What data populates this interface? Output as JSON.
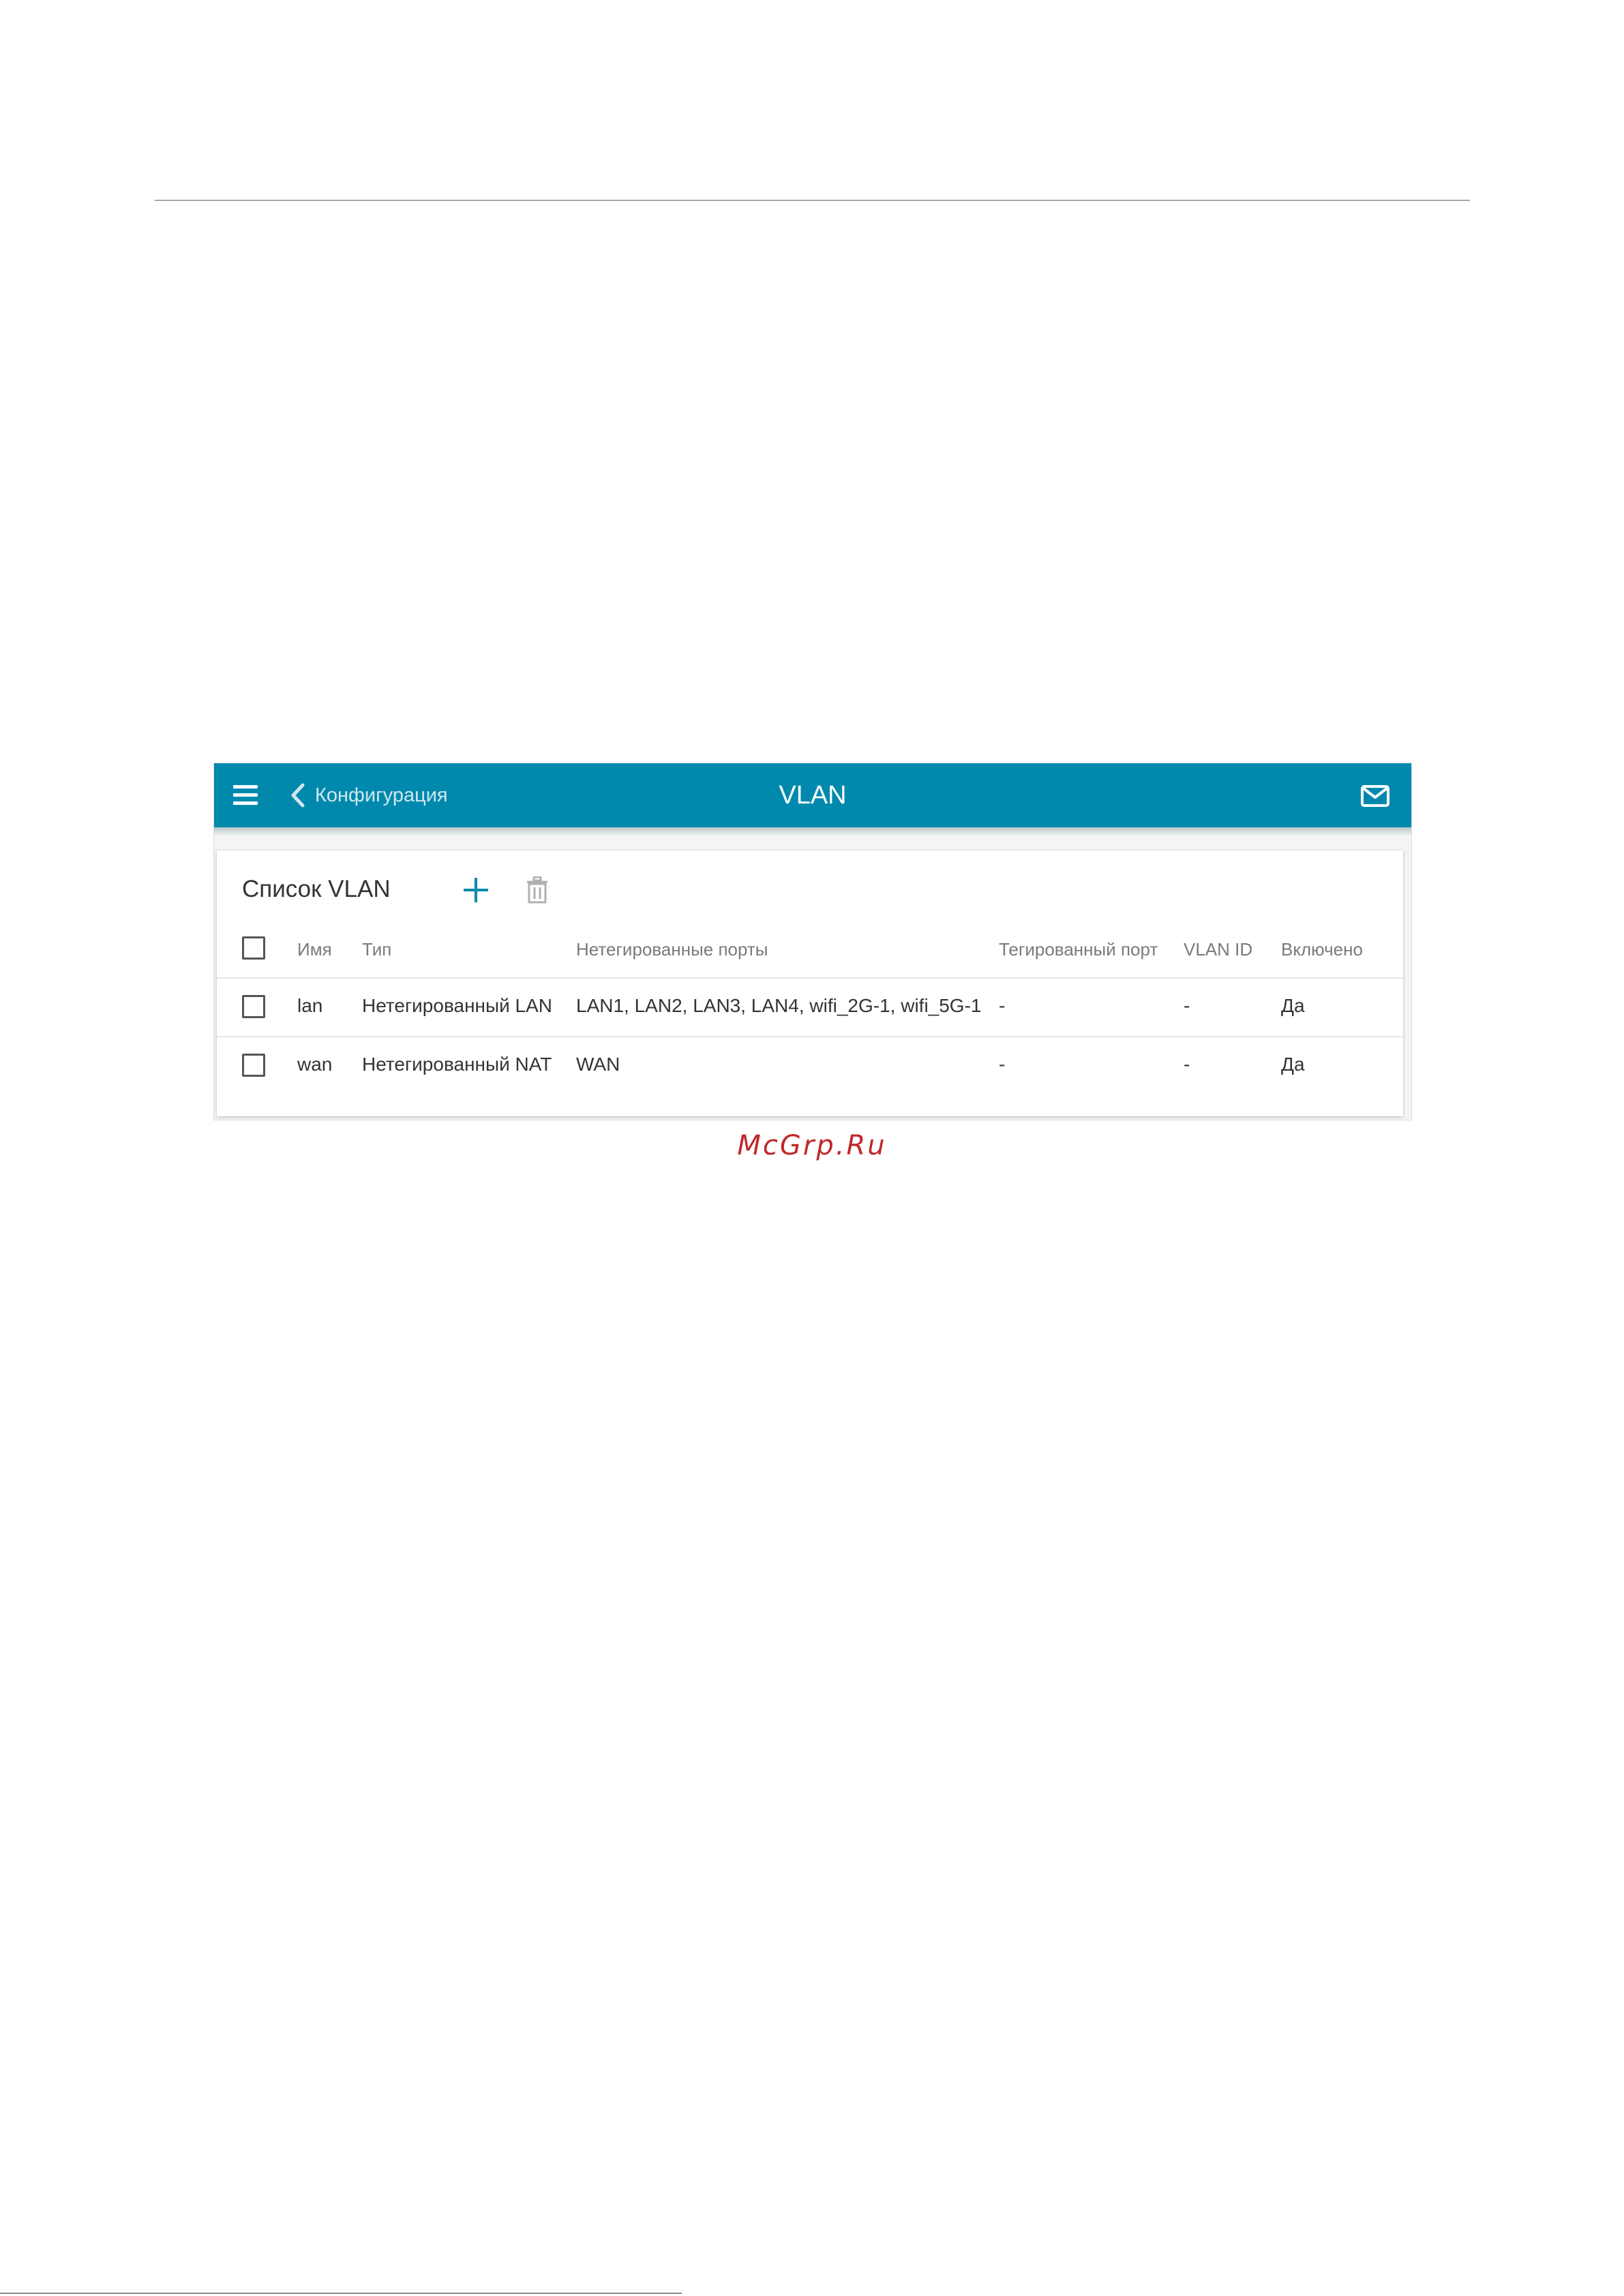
{
  "appbar": {
    "back_label": "Конфигурация",
    "title": "VLAN",
    "bg_color": "#0089ad",
    "icons": [
      "menu-icon",
      "chevron-left-icon",
      "mail-icon"
    ]
  },
  "card": {
    "title": "Список VLAN",
    "icons": [
      "plus-icon",
      "trash-icon"
    ]
  },
  "table": {
    "columns": [
      "Имя",
      "Тип",
      "Нетегированные порты",
      "Тегированный порт",
      "VLAN ID",
      "Включено"
    ],
    "rows": [
      {
        "name": "lan",
        "type": "Нетегированный LAN",
        "untagged": "LAN1, LAN2, LAN3, LAN4, wifi_2G-1, wifi_5G-1",
        "tagged": "-",
        "vlan_id": "-",
        "enabled": "Да"
      },
      {
        "name": "wan",
        "type": "Нетегированный NAT",
        "untagged": "WAN",
        "tagged": "-",
        "vlan_id": "-",
        "enabled": "Да"
      }
    ]
  },
  "watermark": {
    "text": "McGrp.Ru",
    "color": "#c0282b"
  }
}
